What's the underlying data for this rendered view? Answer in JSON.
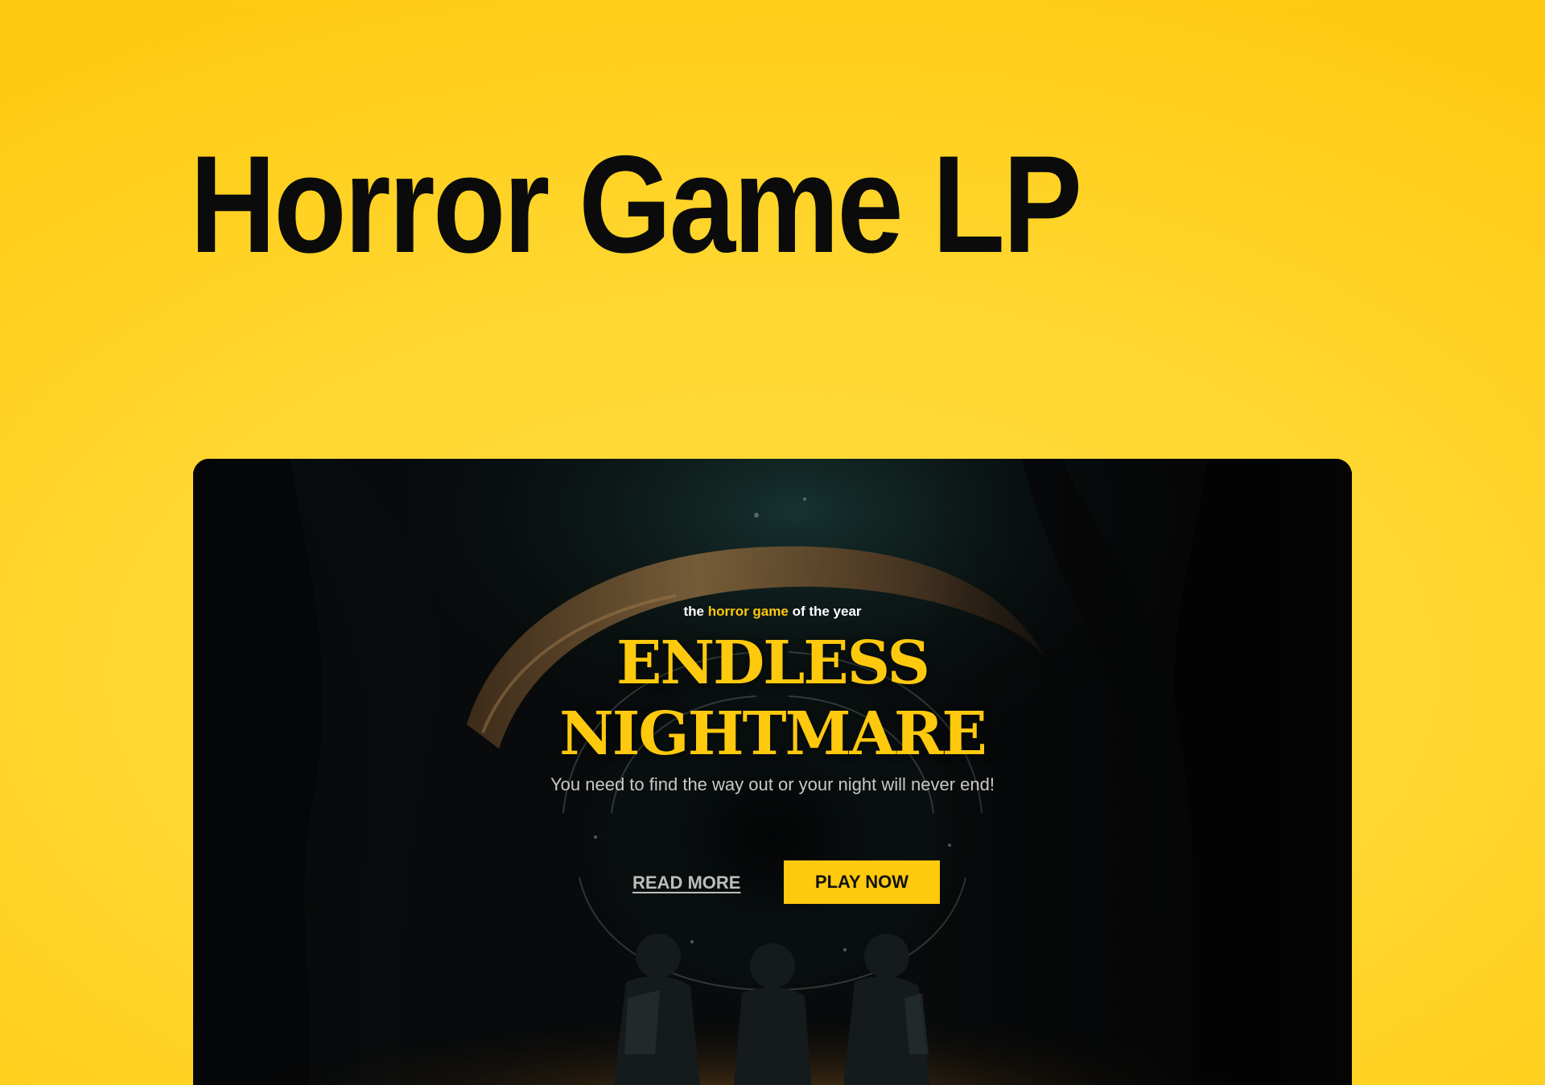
{
  "page": {
    "title": "Horror Game LP"
  },
  "hero": {
    "tagline_before": "the",
    "tagline_highlight": "horror game",
    "tagline_after": "of the year",
    "title_line1": "ENDLESS",
    "title_line2": "NIGHTMARE",
    "subtitle": "You need to find the way out or your night will never end!",
    "read_more_label": "READ MORE",
    "play_now_label": "PLAY NOW"
  },
  "colors": {
    "background": "#ffd62e",
    "accent": "#ffc90d",
    "card_background": "#070506",
    "title_text": "#0b0b0b"
  }
}
